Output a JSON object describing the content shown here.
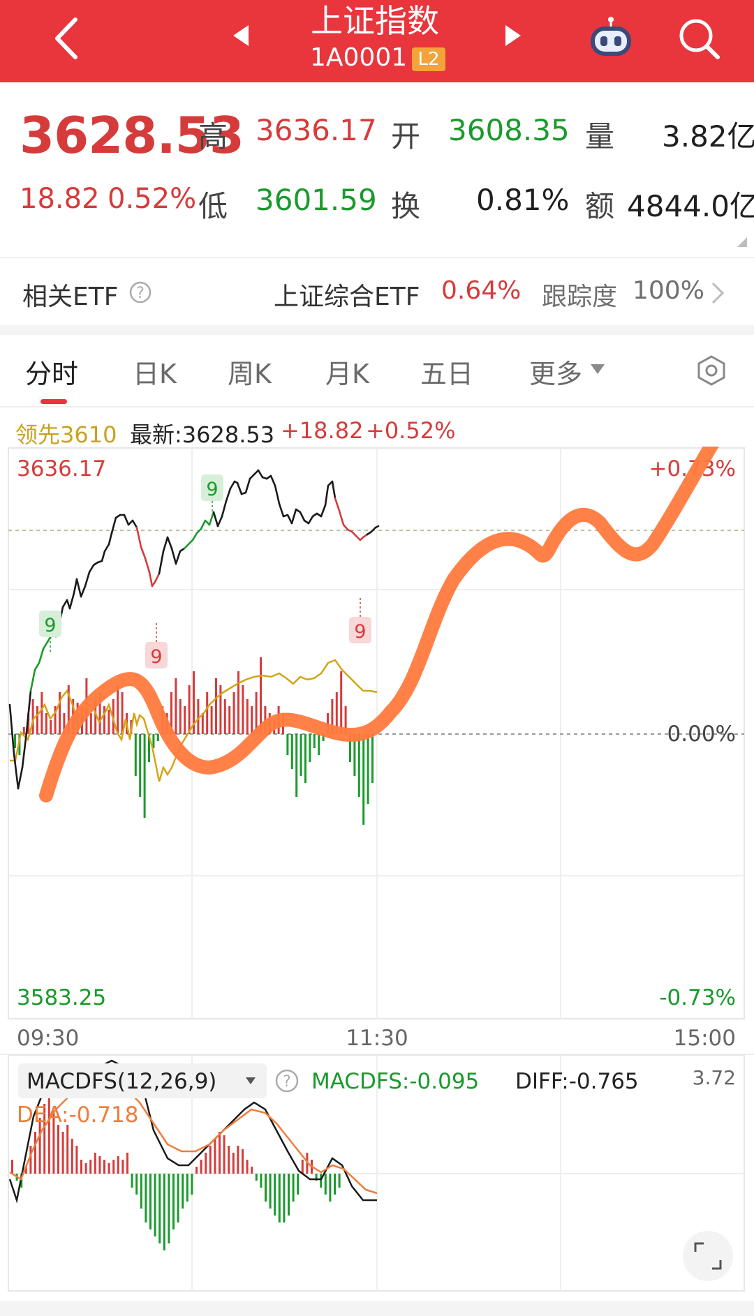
{
  "header": {
    "title": "上证指数",
    "code": "1A0001",
    "level_badge": "L2",
    "icons": {
      "back": "chevron-left-icon",
      "prev": "triangle-left-icon",
      "next": "triangle-right-icon",
      "robot": "robot-icon",
      "search": "search-icon"
    }
  },
  "quote": {
    "price": "3628.53",
    "change": "18.82",
    "change_pct": "0.52%",
    "fields": [
      {
        "label": "高",
        "value": "3636.17",
        "color": "red"
      },
      {
        "label": "开",
        "value": "3608.35",
        "color": "green"
      },
      {
        "label": "量",
        "value": "3.82亿",
        "color": "dark"
      },
      {
        "label": "低",
        "value": "3601.59",
        "color": "green"
      },
      {
        "label": "换",
        "value": "0.81%",
        "color": "dark"
      },
      {
        "label": "额",
        "value": "4844.0亿",
        "color": "dark"
      }
    ]
  },
  "etf": {
    "label": "相关ETF",
    "name": "上证综合ETF",
    "change": "0.64%",
    "tracking_label": "跟踪度",
    "tracking_value": "100%"
  },
  "tabs": [
    "分时",
    "日K",
    "周K",
    "月K",
    "五日",
    "更多"
  ],
  "active_tab": "分时",
  "info": {
    "leader": "领先3610",
    "latest": "最新:3628.53",
    "change": "+18.82",
    "change_pct": "+0.52%"
  },
  "chart": {
    "y_high": "3636.17",
    "y_low": "3583.25",
    "pct_high": "+0.73%",
    "pct_mid": "0.00%",
    "pct_low": "-0.73%",
    "x_start": "09:30",
    "x_mid": "11:30",
    "x_end": "15:00",
    "markers": [
      "9",
      "9",
      "9",
      "9"
    ],
    "colors": {
      "up": "#d63b3b",
      "down": "#1a9a2c",
      "price_line": "#1a1a1a",
      "avg_line": "#d4a417",
      "annotation": "#ff7a3d"
    }
  },
  "macd": {
    "title": "MACDFS(12,26,9)",
    "macdfs": "MACDFS:-0.095",
    "diff": "DIFF:-0.765",
    "dea": "DEA:-0.718",
    "scale": "3.72"
  }
}
